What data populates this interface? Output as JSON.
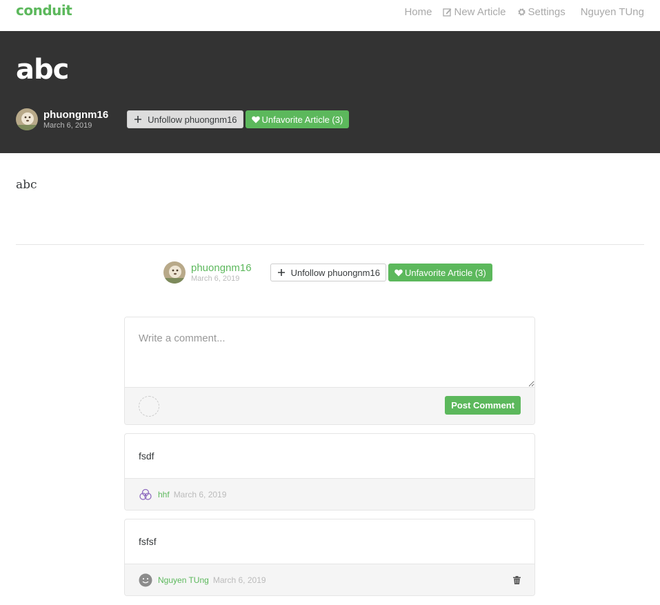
{
  "nav": {
    "brand": "conduit",
    "home": "Home",
    "new_article": "New Article",
    "settings": "Settings",
    "user": "Nguyen TUng"
  },
  "article": {
    "title": "abc",
    "author": "phuongnm16",
    "date": "March 6, 2019",
    "follow_label": "Unfollow phuongnm16",
    "favorite_label": "Unfavorite Article (3)",
    "body": "abc"
  },
  "comment_form": {
    "placeholder": "Write a comment...",
    "post_label": "Post Comment"
  },
  "comments": [
    {
      "body": "fsdf",
      "author": "hhf",
      "date": "March 6, 2019",
      "deletable": false
    },
    {
      "body": "fsfsf",
      "author": "Nguyen TUng",
      "date": "March 6, 2019",
      "deletable": true
    }
  ],
  "colors": {
    "accent": "#5cb85c",
    "banner": "#333333"
  }
}
